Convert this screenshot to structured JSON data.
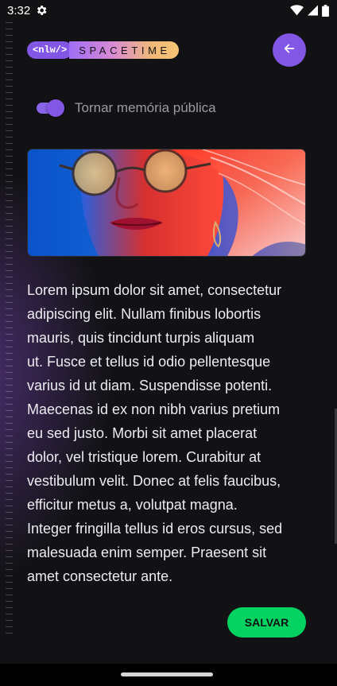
{
  "status_bar": {
    "time": "3:32",
    "icons": [
      "settings-icon",
      "wifi-icon",
      "signal-icon",
      "battery-icon"
    ]
  },
  "header": {
    "logo_code": "<nlw/>",
    "logo_word": "SPACETIME",
    "back_icon": "arrow-left-icon"
  },
  "toggle": {
    "label": "Tornar memória pública",
    "checked": true
  },
  "memory": {
    "text": "Lorem ipsum dolor sit amet, consectetur\nadipiscing elit. Nullam finibus lobortis\nmauris, quis tincidunt turpis aliquam\nut. Fusce et tellus id odio pellentesque\nvarius id ut diam. Suspendisse potenti.\nMaecenas id ex non nibh varius pretium\neu sed justo. Morbi sit amet placerat\ndolor, vel tristique lorem. Curabitur at\nvestibulum velit. Donec at felis faucibus,\nefficitur metus a, volutpat magna.\nInteger fringilla tellus id eros cursus, sed\nmalesuada enim semper. Praesent sit\namet consectetur ante."
  },
  "actions": {
    "save_label": "SALVAR"
  },
  "colors": {
    "background": "#121214",
    "accent_purple": "#8257e5",
    "save_green": "#04d361"
  }
}
